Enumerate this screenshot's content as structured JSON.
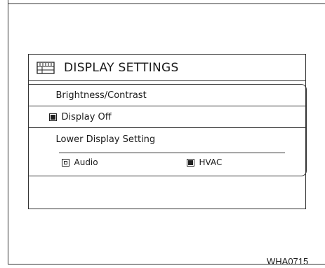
{
  "header": {
    "title": "DISPLAY SETTINGS",
    "icon": "display-settings-icon"
  },
  "menu": {
    "brightness_label": "Brightness/Contrast",
    "display_off_label": "Display Off",
    "display_off_checked": true,
    "lower_display_label": "Lower Display Setting",
    "lower_options": [
      {
        "label": "Audio",
        "checked": false
      },
      {
        "label": "HVAC",
        "checked": true
      }
    ]
  },
  "figure_code": "WHA0715"
}
